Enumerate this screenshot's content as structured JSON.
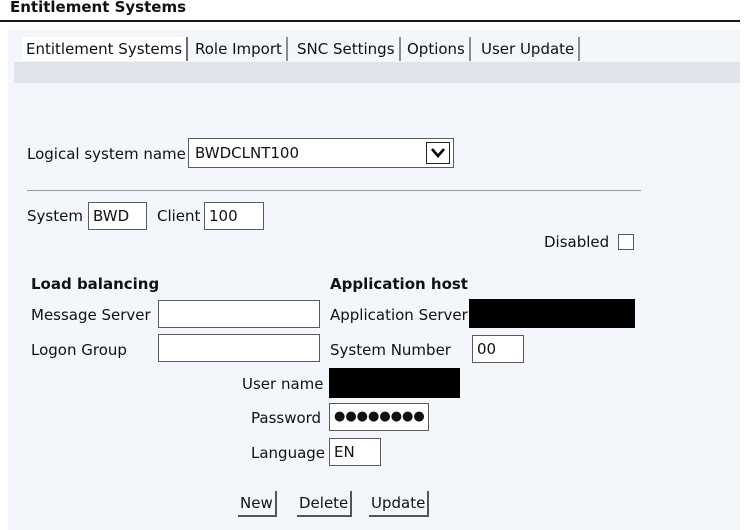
{
  "window": {
    "title": "Entitlement Systems"
  },
  "tabs": [
    {
      "label": "Entitlement Systems",
      "active": true
    },
    {
      "label": "Role Import",
      "active": false
    },
    {
      "label": "SNC Settings",
      "active": false
    },
    {
      "label": "Options",
      "active": false
    },
    {
      "label": "User Update",
      "active": false
    }
  ],
  "form": {
    "logical_system_label": "Logical system name",
    "logical_system_value": "BWDCLNT100",
    "system_label": "System",
    "system_value": "BWD",
    "client_label": "Client",
    "client_value": "100",
    "disabled_label": "Disabled",
    "disabled_checked": false,
    "load_balancing_heading": "Load balancing",
    "message_server_label": "Message Server",
    "message_server_value": "",
    "logon_group_label": "Logon Group",
    "logon_group_value": "",
    "application_host_heading": "Application host",
    "application_server_label": "Application Server",
    "system_number_label": "System Number",
    "system_number_value": "00",
    "user_name_label": "User name",
    "password_label": "Password",
    "password_value": "●●●●●●●●",
    "language_label": "Language",
    "language_value": "EN"
  },
  "buttons": {
    "new": "New",
    "delete": "Delete",
    "update": "Update"
  }
}
